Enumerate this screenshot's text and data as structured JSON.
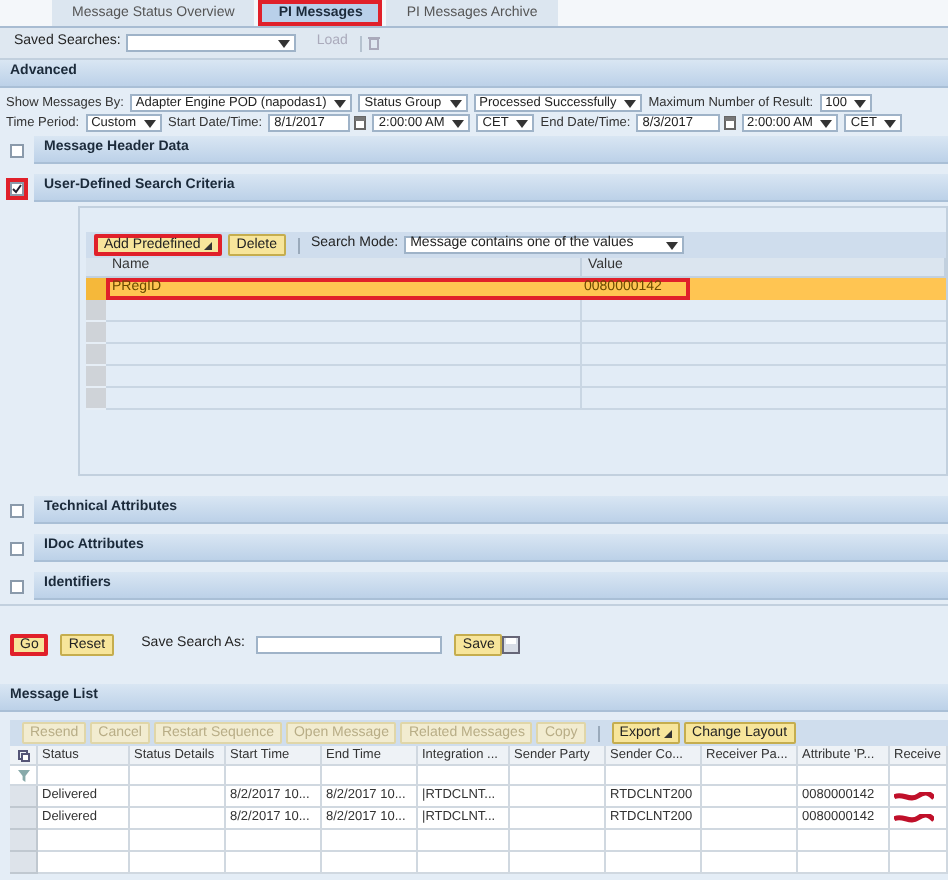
{
  "tabs": [
    {
      "label": "Message Status Overview",
      "selected": false,
      "highlighted": false
    },
    {
      "label": "PI Messages",
      "selected": true,
      "highlighted": true
    },
    {
      "label": "PI Messages Archive",
      "selected": false,
      "highlighted": false
    }
  ],
  "saved_searches": {
    "label": "Saved Searches:",
    "load_button": {
      "label": "Load",
      "disabled": true
    }
  },
  "advanced": {
    "title": "Advanced",
    "show_messages": {
      "label": "Show Messages By:",
      "controls": [
        {
          "kind": "select",
          "text": "Adapter Engine POD (napodas1)"
        },
        {
          "kind": "select",
          "text": "Status Group"
        },
        {
          "kind": "select",
          "text": "Processed Successfully"
        }
      ]
    },
    "max_results": {
      "label": "Maximum Number of Result:",
      "controls": [
        {
          "kind": "select",
          "text": "100"
        }
      ]
    },
    "time_period": {
      "label": "Time Period:",
      "controls": [
        {
          "kind": "select",
          "text": "Custom"
        }
      ]
    },
    "start": {
      "label": "Start Date/Time:",
      "controls": [
        {
          "kind": "date",
          "text": "8/1/2017"
        },
        {
          "kind": "select",
          "text": "2:00:00 AM"
        },
        {
          "kind": "select",
          "text": "CET"
        }
      ]
    },
    "end": {
      "label": "End Date/Time:",
      "controls": [
        {
          "kind": "date",
          "text": "8/3/2017"
        },
        {
          "kind": "select",
          "text": "2:00:00 AM"
        },
        {
          "kind": "select",
          "text": "CET"
        }
      ]
    }
  },
  "sections": [
    {
      "title": "Message Header Data",
      "checked": false,
      "highlighted": false
    },
    {
      "title": "User-Defined Search Criteria",
      "checked": true,
      "highlighted": true,
      "criteria": {
        "add_button": {
          "label": "Add Predefined",
          "highlighted": true
        },
        "delete_button": "Delete",
        "search_mode_label": "Search Mode:",
        "search_mode": "Message contains one of the values",
        "columns": [
          "Name",
          "Value"
        ],
        "rows": [
          {
            "name": "PRegID",
            "value": "0080000142",
            "selected": true,
            "highlighted": true
          }
        ]
      }
    },
    {
      "title": "Technical Attributes",
      "checked": false,
      "highlighted": false
    },
    {
      "title": "IDoc Attributes",
      "checked": false,
      "highlighted": false
    },
    {
      "title": "Identifiers",
      "checked": false,
      "highlighted": false
    }
  ],
  "actions": {
    "go": {
      "label": "Go",
      "highlighted": true
    },
    "reset": "Reset",
    "save_label": "Save Search As:",
    "save": "Save"
  },
  "message_list": {
    "title": "Message List",
    "toolbar": [
      {
        "label": "Resend",
        "disabled": true,
        "menu": false
      },
      {
        "label": "Cancel",
        "disabled": true,
        "menu": false
      },
      {
        "label": "Restart Sequence",
        "disabled": true,
        "menu": false
      },
      {
        "label": "Open Message",
        "disabled": true,
        "menu": false
      },
      {
        "label": "Related Messages",
        "disabled": true,
        "menu": false
      },
      {
        "label": "Copy",
        "disabled": true,
        "menu": false
      },
      {
        "label": "Export",
        "disabled": false,
        "menu": true
      },
      {
        "label": "Change Layout",
        "disabled": false,
        "menu": false
      }
    ],
    "columns": [
      "Status",
      "Status Details",
      "Start Time",
      "End Time",
      "Integration ...",
      "Sender Party",
      "Sender Co...",
      "Receiver Pa...",
      "Attribute 'P...",
      "Receive"
    ],
    "rows": [
      {
        "cells": [
          "Delivered",
          null,
          "8/2/2017 10...",
          "8/2/2017 10...",
          "|RTDCLNT...",
          null,
          "RTDCLNT200",
          null,
          "0080000142",
          null
        ],
        "redacted": true
      },
      {
        "cells": [
          "Delivered",
          null,
          "8/2/2017 10...",
          "8/2/2017 10...",
          "|RTDCLNT...",
          null,
          "RTDCLNT200",
          null,
          "0080000142",
          null
        ],
        "redacted": true
      }
    ]
  }
}
